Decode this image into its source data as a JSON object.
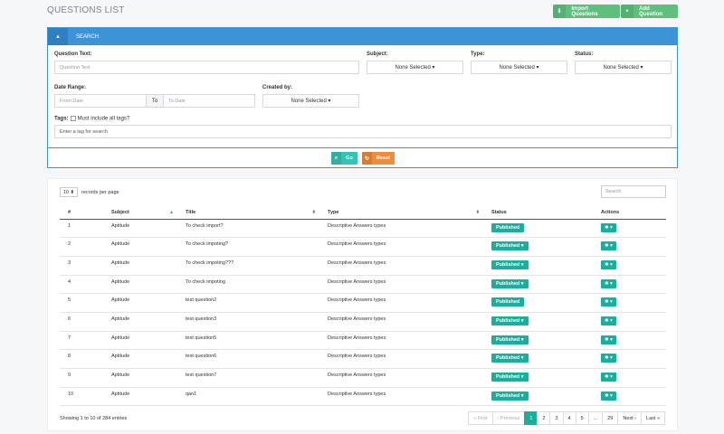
{
  "header": {
    "title": "QUESTIONS LIST",
    "import_label": "Import Questions",
    "add_label": "Add Question"
  },
  "search": {
    "title": "SEARCH",
    "question_text_label": "Question Text:",
    "question_text_placeholder": "Question Text",
    "subject_label": "Subject:",
    "type_label": "Type:",
    "status_label": "Status:",
    "none_selected": "None Selected",
    "date_range_label": "Date Range:",
    "from_placeholder": "From Date",
    "to_label": "To",
    "to_placeholder": "To Date",
    "created_by_label": "Created by:",
    "tags_label": "Tags:",
    "must_include_label": "Must include all tags?",
    "tag_placeholder": "Enter a tag for search",
    "go_label": "Go",
    "reset_label": "Reset"
  },
  "table": {
    "per_page_value": "10",
    "per_page_label": "records per page",
    "search_placeholder": "Search",
    "columns": [
      "#",
      "Subject",
      "Title",
      "Type",
      "Status",
      "Actions"
    ],
    "rows": [
      {
        "num": "1",
        "subject": "Aptitude",
        "title": "To check import?",
        "type": "Descriptive Answers types",
        "status": "Published",
        "has_caret": false
      },
      {
        "num": "2",
        "subject": "Aptitude",
        "title": "To check impoting?",
        "type": "Descriptive Answers types",
        "status": "Published",
        "has_caret": true
      },
      {
        "num": "3",
        "subject": "Aptitude",
        "title": "To check impoting???",
        "type": "Descriptive Answers types",
        "status": "Published",
        "has_caret": true
      },
      {
        "num": "4",
        "subject": "Aptitude",
        "title": "To check impoting",
        "type": "Descriptive Answers types",
        "status": "Published",
        "has_caret": true
      },
      {
        "num": "5",
        "subject": "Aptitude",
        "title": "test question2",
        "type": "Descriptive Answers types",
        "status": "Published",
        "has_caret": false
      },
      {
        "num": "6",
        "subject": "Aptitude",
        "title": "test question3",
        "type": "Descriptive Answers types",
        "status": "Published",
        "has_caret": true
      },
      {
        "num": "7",
        "subject": "Aptitude",
        "title": "test question5",
        "type": "Descriptive Answers types",
        "status": "Published",
        "has_caret": true
      },
      {
        "num": "8",
        "subject": "Aptitude",
        "title": "test question6",
        "type": "Descriptive Answers types",
        "status": "Published",
        "has_caret": true
      },
      {
        "num": "9",
        "subject": "Aptitude",
        "title": "test question7",
        "type": "Descriptive Answers types",
        "status": "Published",
        "has_caret": true
      },
      {
        "num": "10",
        "subject": "Aptitude",
        "title": "qan1",
        "type": "Descriptive Answers types",
        "status": "Published",
        "has_caret": true
      }
    ],
    "info": "Showing 1 to 10 of 284 entries"
  },
  "pagination": {
    "first": "« First",
    "previous": "‹ Previous",
    "pages": [
      "1",
      "2",
      "3",
      "4",
      "5",
      "...",
      "29"
    ],
    "next": "Next ›",
    "last": "Last »",
    "active": "1"
  },
  "colors": {
    "primary": "#3c94d6",
    "success": "#5fbf7d",
    "teal": "#18b09d",
    "orange": "#ef8c3c"
  }
}
